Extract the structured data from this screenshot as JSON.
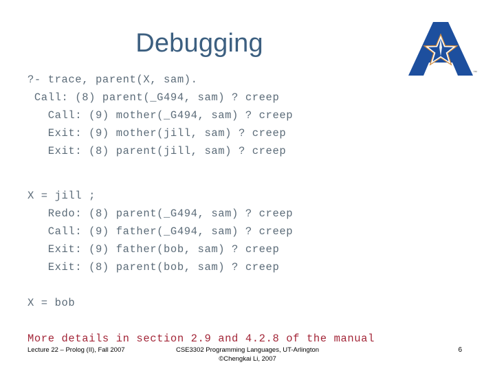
{
  "slide": {
    "title": "Debugging",
    "title_color": "#3c5f80",
    "background": "#ffffff"
  },
  "logo": {
    "name": "ut-arlington-a-star-logo",
    "trademark": "™",
    "blue": "#1d4f9e",
    "star_outline": "#d08a3a",
    "star_fill": "#ffffff",
    "star_inner": "#1d4f9e"
  },
  "code": {
    "color": "#5b6b78",
    "block_one": [
      "?- trace, parent(X, sam).",
      " Call: (8) parent(_G494, sam) ? creep",
      "   Call: (9) mother(_G494, sam) ? creep",
      "   Exit: (9) mother(jill, sam) ? creep",
      "   Exit: (8) parent(jill, sam) ? creep"
    ],
    "block_two": [
      "X = jill ;",
      "   Redo: (8) parent(_G494, sam) ? creep",
      "   Call: (9) father(_G494, sam) ? creep",
      "   Exit: (9) father(bob, sam) ? creep",
      "   Exit: (8) parent(bob, sam) ? creep"
    ],
    "result": "X = bob"
  },
  "note": {
    "text": "More details in section 2.9 and 4.2.8 of the manual",
    "color": "#a32638"
  },
  "footer": {
    "left": "Lecture 22 – Prolog (II), Fall 2007",
    "center_line1": "CSE3302 Programming Languages, UT-Arlington",
    "center_line2": "©Chengkai Li, 2007",
    "page_number": "6"
  }
}
